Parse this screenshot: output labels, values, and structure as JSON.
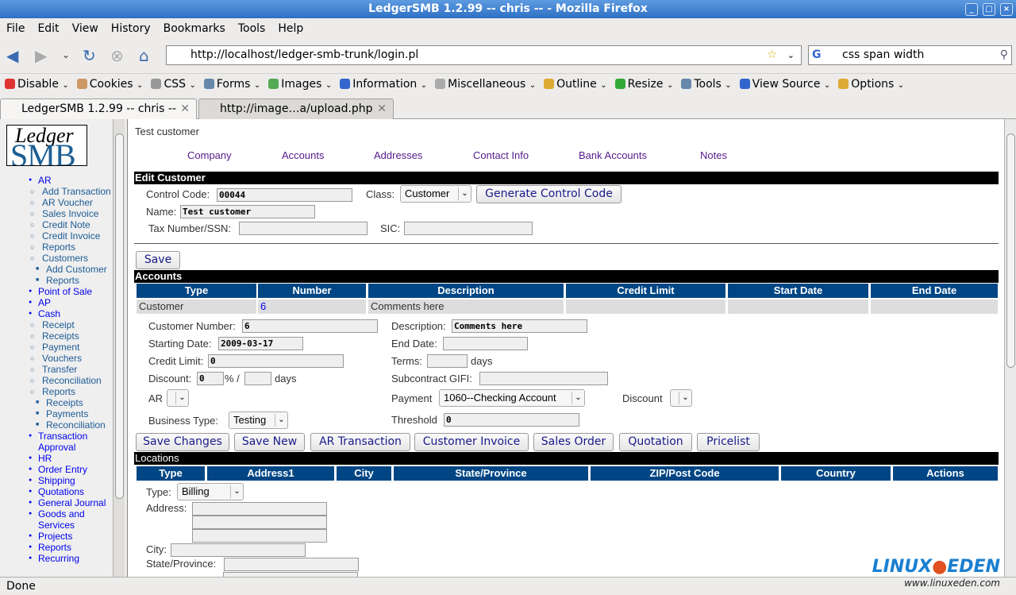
{
  "window": {
    "title": "LedgerSMB 1.2.99 -- chris -- - Mozilla Firefox"
  },
  "menu": [
    "File",
    "Edit",
    "View",
    "History",
    "Bookmarks",
    "Tools",
    "Help"
  ],
  "nav": {
    "url": "http://localhost/ledger-smb-trunk/login.pl",
    "search": "css span width"
  },
  "devtoolbar": [
    {
      "label": "Disable",
      "color": "#d33"
    },
    {
      "label": "Cookies",
      "color": "#c96"
    },
    {
      "label": "CSS",
      "color": "#999"
    },
    {
      "label": "Forms",
      "color": "#68a"
    },
    {
      "label": "Images",
      "color": "#5a5"
    },
    {
      "label": "Information",
      "color": "#36c"
    },
    {
      "label": "Miscellaneous",
      "color": "#aaa"
    },
    {
      "label": "Outline",
      "color": "#da3"
    },
    {
      "label": "Resize",
      "color": "#3a3"
    },
    {
      "label": "Tools",
      "color": "#68a"
    },
    {
      "label": "View Source",
      "color": "#36c"
    },
    {
      "label": "Options",
      "color": "#da3"
    }
  ],
  "tabs": [
    {
      "label": "LedgerSMB 1.2.99 -- chris --"
    },
    {
      "label": "http://image…a/upload.php"
    }
  ],
  "sidebar": {
    "logo": "Ledger SMB",
    "items": [
      {
        "label": "AR",
        "level": 0
      },
      {
        "label": "Add Transaction",
        "level": 1
      },
      {
        "label": "AR Voucher",
        "level": 1
      },
      {
        "label": "Sales Invoice",
        "level": 1
      },
      {
        "label": "Credit Note",
        "level": 1
      },
      {
        "label": "Credit Invoice",
        "level": 1
      },
      {
        "label": "Reports",
        "level": 1
      },
      {
        "label": "Customers",
        "level": 1
      },
      {
        "label": "Add Customer",
        "level": 2
      },
      {
        "label": "Reports",
        "level": 2
      },
      {
        "label": "Point of Sale",
        "level": 0
      },
      {
        "label": "AP",
        "level": 0
      },
      {
        "label": "Cash",
        "level": 0
      },
      {
        "label": "Receipt",
        "level": 1
      },
      {
        "label": "Receipts",
        "level": 1
      },
      {
        "label": "Payment",
        "level": 1
      },
      {
        "label": "Vouchers",
        "level": 1
      },
      {
        "label": "Transfer",
        "level": 1
      },
      {
        "label": "Reconciliation",
        "level": 1
      },
      {
        "label": "Reports",
        "level": 1
      },
      {
        "label": "Receipts",
        "level": 2
      },
      {
        "label": "Payments",
        "level": 2
      },
      {
        "label": "Reconciliation",
        "level": 2
      },
      {
        "label": "Transaction Approval",
        "level": 0
      },
      {
        "label": "HR",
        "level": 0
      },
      {
        "label": "Order Entry",
        "level": 0
      },
      {
        "label": "Shipping",
        "level": 0
      },
      {
        "label": "Quotations",
        "level": 0
      },
      {
        "label": "General Journal",
        "level": 0
      },
      {
        "label": "Goods and Services",
        "level": 0
      },
      {
        "label": "Projects",
        "level": 0
      },
      {
        "label": "Reports",
        "level": 0
      },
      {
        "label": "Recurring",
        "level": 0
      }
    ]
  },
  "page": {
    "heading": "Test customer",
    "tabs": [
      "Company",
      "Accounts",
      "Addresses",
      "Contact Info",
      "Bank Accounts",
      "Notes"
    ],
    "edit": {
      "title": "Edit Customer",
      "control_code_label": "Control Code:",
      "control_code": "00044",
      "class_label": "Class:",
      "class": "Customer",
      "generate": "Generate Control Code",
      "name_label": "Name:",
      "name": "Test customer",
      "tax_label": "Tax Number/SSN:",
      "tax": "",
      "sic_label": "SIC:",
      "sic": "",
      "save": "Save"
    },
    "accounts": {
      "title": "Accounts",
      "headers": [
        "Type",
        "Number",
        "Description",
        "Credit Limit",
        "Start Date",
        "End Date"
      ],
      "row": [
        "Customer",
        "6",
        "Comments here",
        "",
        "",
        ""
      ],
      "customer_number_label": "Customer Number:",
      "customer_number": "6",
      "description_label": "Description:",
      "description": "Comments here",
      "start_label": "Starting Date:",
      "start": "2009-03-17",
      "end_label": "End Date:",
      "end": "",
      "credit_label": "Credit Limit:",
      "credit": "0",
      "terms_label": "Terms:",
      "terms": "",
      "days": "days",
      "discount_label": "Discount:",
      "discount": "0",
      "pct": "% /",
      "discount_days": "",
      "gifi_label": "Subcontract GIFI:",
      "gifi": "",
      "ar_label": "AR",
      "ar": "",
      "payment_label": "Payment",
      "payment": "1060--Checking Account",
      "discount2_label": "Discount",
      "discount2": "",
      "business_label": "Business Type:",
      "business": "Testing",
      "threshold_label": "Threshold",
      "threshold": "0",
      "buttons": [
        "Save Changes",
        "Save New",
        "AR Transaction",
        "Customer Invoice",
        "Sales Order",
        "Quotation",
        "Pricelist"
      ]
    },
    "locations": {
      "title": "Locations",
      "headers": [
        "Type",
        "Address1",
        "City",
        "State/Province",
        "ZIP/Post Code",
        "Country",
        "Actions"
      ],
      "type_label": "Type:",
      "type": "Billing",
      "address_label": "Address:",
      "city_label": "City:",
      "state_label": "State/Province:"
    }
  },
  "status": "Done",
  "watermark": "LINUXEDEN www.linuxeden.com"
}
